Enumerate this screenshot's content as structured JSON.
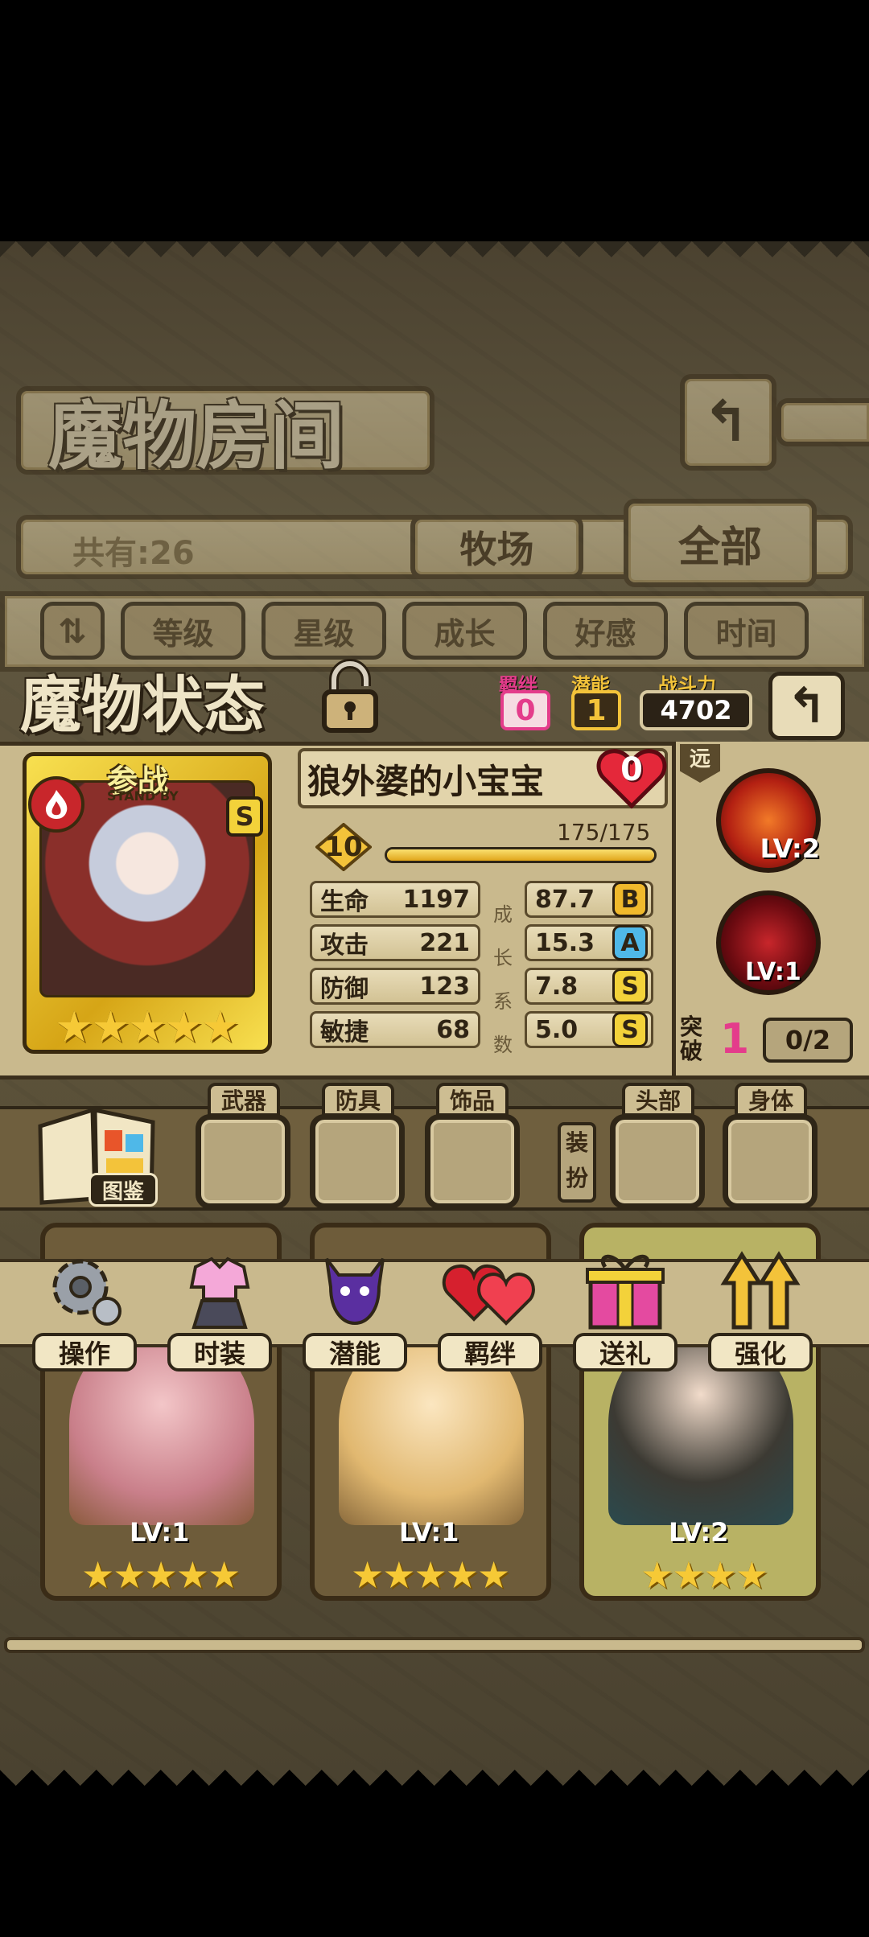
{
  "room": {
    "title": "魔物房间",
    "count_label": "共有:26",
    "tabs": [
      "牧场",
      "全部"
    ],
    "sort_buttons": [
      "等级",
      "星级",
      "成长",
      "好感",
      "时间"
    ]
  },
  "status": {
    "title": "魔物状态",
    "bond_label": "羁绊",
    "bond_value": "0",
    "potential_label": "潜能",
    "potential_value": "1",
    "power_label": "战斗力",
    "power_value": "4702",
    "name": "狼外婆的小宝宝",
    "affection": "0",
    "level": "10",
    "exp": "175/175",
    "exp_fraction": 1.0,
    "standby_label": "参战",
    "standby_sub": "STAND BY",
    "rank_badge": "S",
    "stars": 5,
    "growth_label": "成长系数",
    "stats": [
      {
        "label": "生命",
        "value": "1197",
        "growth": "87.7",
        "grade": "B",
        "grade_color": "#f0b92c"
      },
      {
        "label": "攻击",
        "value": "221",
        "growth": "15.3",
        "grade": "A",
        "grade_color": "#4fb8e8"
      },
      {
        "label": "防御",
        "value": "123",
        "growth": "7.8",
        "grade": "S",
        "grade_color": "#f3d23a"
      },
      {
        "label": "敏捷",
        "value": "68",
        "growth": "5.0",
        "grade": "S",
        "grade_color": "#f3d23a"
      }
    ],
    "range_label": "远",
    "skills": [
      {
        "level": "LV:2",
        "icon": "arrows-skill-icon"
      },
      {
        "level": "LV:1",
        "icon": "blood-skill-icon"
      }
    ],
    "breakthrough_label": "突破",
    "breakthrough_value": "1",
    "breakthrough_progress": "0/2"
  },
  "equipment": {
    "codex_label": "图鉴",
    "slots": [
      "武器",
      "防具",
      "饰品"
    ],
    "dress_label": "装扮",
    "dress_slots": [
      "头部",
      "身体"
    ]
  },
  "actions": [
    "操作",
    "时装",
    "潜能",
    "羁绊",
    "送礼",
    "强化"
  ],
  "cards": [
    {
      "level": "LV:1",
      "stars": 5
    },
    {
      "level": "LV:1",
      "stars": 5
    },
    {
      "level": "LV:2",
      "stars": 4
    }
  ],
  "colors": {
    "accent_gold": "#f3c33a",
    "panel": "#d9cba3",
    "dark_frame": "#2f2617",
    "pink_value": "#e43c8b"
  }
}
